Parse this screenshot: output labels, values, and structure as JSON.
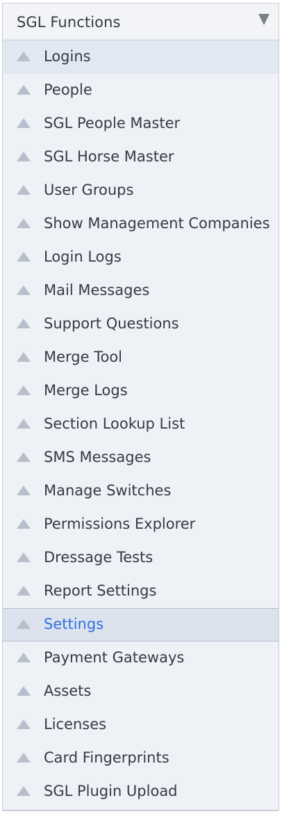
{
  "header": {
    "title": "SGL Functions",
    "toggle_icon": "caret-down-icon"
  },
  "menu": {
    "item_icon": "triangle-up-icon",
    "hovered_item": "Logins",
    "selected_item": "Settings",
    "items": [
      {
        "label": "Logins"
      },
      {
        "label": "People"
      },
      {
        "label": "SGL People Master"
      },
      {
        "label": "SGL Horse Master"
      },
      {
        "label": "User Groups"
      },
      {
        "label": "Show Management Companies"
      },
      {
        "label": "Login Logs"
      },
      {
        "label": "Mail Messages"
      },
      {
        "label": "Support Questions"
      },
      {
        "label": "Merge Tool"
      },
      {
        "label": "Merge Logs"
      },
      {
        "label": "Section Lookup List"
      },
      {
        "label": "SMS Messages"
      },
      {
        "label": "Manage Switches"
      },
      {
        "label": "Permissions Explorer"
      },
      {
        "label": "Dressage Tests"
      },
      {
        "label": "Report Settings"
      },
      {
        "label": "Settings"
      },
      {
        "label": "Payment Gateways"
      },
      {
        "label": "Assets"
      },
      {
        "label": "Licenses"
      },
      {
        "label": "Card Fingerprints"
      },
      {
        "label": "SGL Plugin Upload"
      }
    ]
  },
  "colors": {
    "selected_text": "#2f6fe0",
    "selected_background": "#dde3ee",
    "panel_background": "#eef1f5",
    "icon": "#b8bfcc"
  }
}
